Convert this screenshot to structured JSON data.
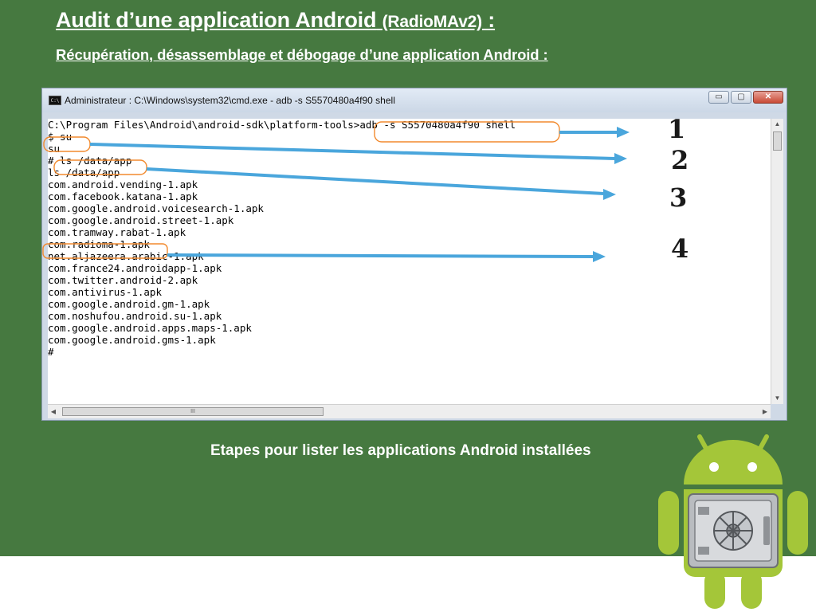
{
  "slide": {
    "title_main": "Audit d’une application Android",
    "title_paren": "(RadioMAv2)",
    "title_colon": " :",
    "subtitle": "Récupération, désassemblage et débogage d’une application Android  :",
    "caption": "Etapes pour lister les applications Android installées",
    "colors": {
      "background": "#467940",
      "text": "#ffffff",
      "highlight": "#f28a2e",
      "arrow": "#4aa6dc"
    }
  },
  "window": {
    "title": "Administrateur : C:\\Windows\\system32\\cmd.exe - adb  -s S5570480a4f90 shell",
    "icon": "cmd-icon",
    "buttons": {
      "minimize": "▭",
      "maximize": "▢",
      "close": "✕"
    }
  },
  "console": {
    "lines": [
      "C:\\Program Files\\Android\\android-sdk\\platform-tools>adb -s S5570480a4f90 shell",
      "$ su",
      "su",
      "# ls /data/app",
      "ls /data/app",
      "com.android.vending-1.apk",
      "com.facebook.katana-1.apk",
      "com.google.android.voicesearch-1.apk",
      "com.google.android.street-1.apk",
      "com.tramway.rabat-1.apk",
      "com.radioma-1.apk",
      "net.aljazeera.arabic-1.apk",
      "com.france24.androidapp-1.apk",
      "com.twitter.android-2.apk",
      "com.antivirus-1.apk",
      "com.google.android.gm-1.apk",
      "com.noshufou.android.su-1.apk",
      "com.google.android.apps.maps-1.apk",
      "com.google.android.gms-1.apk",
      "#"
    ]
  },
  "scrollbar": {
    "h_thumb_grip": "III"
  },
  "steps": [
    "1",
    "2",
    "3",
    "4"
  ]
}
